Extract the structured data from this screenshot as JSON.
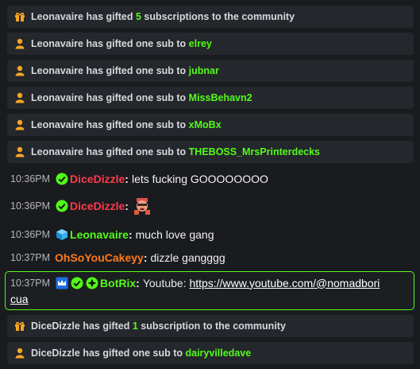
{
  "colors": {
    "accent": "#53fc18",
    "dice": "#ff3a4a",
    "leon": "#53fc18",
    "ohso": "#ff7a1a",
    "botrix": "#53fc18",
    "bg": "#191b1f",
    "card": "#24272c"
  },
  "gifts": [
    {
      "icon": "gift-icon",
      "user": "Leonavaire",
      "text1": " has gifted ",
      "count": "5",
      "text2": " subscriptions to the community",
      "target": ""
    },
    {
      "icon": "user-icon",
      "user": "Leonavaire",
      "text1": " has gifted one sub to ",
      "count": "",
      "text2": "",
      "target": "elrey"
    },
    {
      "icon": "user-icon",
      "user": "Leonavaire",
      "text1": " has gifted one sub to ",
      "count": "",
      "text2": "",
      "target": "jubnar"
    },
    {
      "icon": "user-icon",
      "user": "Leonavaire",
      "text1": " has gifted one sub to ",
      "count": "",
      "text2": "",
      "target": "MissBehavn2"
    },
    {
      "icon": "user-icon",
      "user": "Leonavaire",
      "text1": " has gifted one sub to ",
      "count": "",
      "text2": "",
      "target": "xMoBx"
    },
    {
      "icon": "user-icon",
      "user": "Leonavaire",
      "text1": " has gifted one sub to ",
      "count": "",
      "text2": "",
      "target": "THEBOSS_MrsPrinterdecks"
    }
  ],
  "messages": [
    {
      "time": "10:36PM",
      "user": "DiceDizzle",
      "text": "lets fucking GOOOOOOOO"
    },
    {
      "time": "10:36PM",
      "user": "DiceDizzle",
      "text": ""
    },
    {
      "time": "10:36PM",
      "user": "Leonavaire",
      "text": "much love gang"
    },
    {
      "time": "10:37PM",
      "user": "OhSoYouCakeyy",
      "text": "dizzle gangggg"
    }
  ],
  "highlight": {
    "time": "10:37PM",
    "user": "BotRix",
    "text": "Youtube: ",
    "link_part1": "https://www.youtube.com/@nomadbori",
    "link_part2": "cua"
  },
  "gifts_bottom": [
    {
      "icon": "gift-icon",
      "user": "DiceDizzle",
      "text1": " has gifted ",
      "count": "1",
      "text2": " subscription to the community",
      "target": ""
    },
    {
      "icon": "user-icon",
      "user": "DiceDizzle",
      "text1": " has gifted one sub to ",
      "count": "",
      "text2": "",
      "target": "dairyvilledave"
    }
  ]
}
